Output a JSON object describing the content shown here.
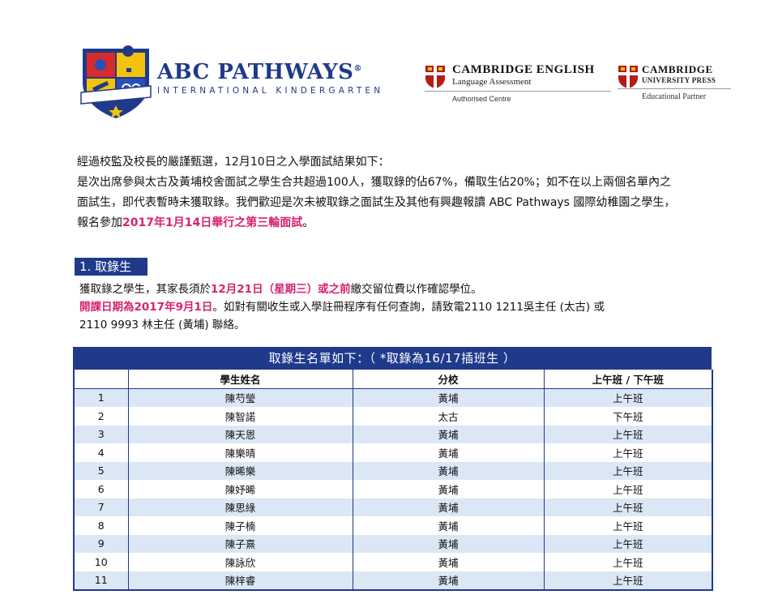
{
  "header": {
    "brand_name": "ABC PATHWAYS",
    "brand_mark": "®",
    "brand_sub": "INTERNATIONAL KINDERGARTEN",
    "crest_text": "ABC PATHWAYS",
    "cambridge_english": {
      "title": "CAMBRIDGE ENGLISH",
      "subtitle": "Language Assessment",
      "note": "Authorised Centre"
    },
    "cambridge_press": {
      "title": "CAMBRIDGE",
      "subtitle": "UNIVERSITY PRESS",
      "note": "Educational Partner"
    }
  },
  "intro": {
    "line1": "經過校監及校長的嚴謹甄選，12月10日之入學面試結果如下：",
    "line2": "是次出席參與太古及黃埔校舍面試之學生合共超過100人，獲取錄的佔67%，備取生佔20%；如不在以上兩個名單內之",
    "line3": "面試生，即代表暫時未獲取錄。我們歡迎是次未被取錄之面試生及其他有興趣報讀 ABC Pathways 國際幼稚園之學生，",
    "line4_a": "報名參加",
    "line4_b": "2017年1月14日舉行之第三輪面試",
    "line4_c": "。"
  },
  "section": {
    "heading": "1. 取錄生",
    "l1_a": "獲取錄之學生，其家長須於",
    "l1_b": "12月21日（星期三）或之前",
    "l1_c": "繳交留位費以作確認學位。",
    "l2_a": "開課日期為2017年9月1日",
    "l2_b": "。如對有關收生或入學註冊程序有任何查詢，請致電2110 1211吳主任 (太古) 或",
    "l3": "2110 9993 林主任 (黃埔) 聯絡。"
  },
  "table": {
    "title": "取錄生名單如下：（ *取錄為16/17插班生 ）",
    "headers": [
      "",
      "學生姓名",
      "分校",
      "上午班 / 下午班"
    ],
    "rows": [
      [
        "1",
        "陳芍瑩",
        "黃埔",
        "上午班"
      ],
      [
        "2",
        "陳智諾",
        "太古",
        "下午班"
      ],
      [
        "3",
        "陳天恩",
        "黃埔",
        "上午班"
      ],
      [
        "4",
        "陳樂晴",
        "黃埔",
        "上午班"
      ],
      [
        "5",
        "陳晞樂",
        "黃埔",
        "上午班"
      ],
      [
        "6",
        "陳妤晞",
        "黃埔",
        "上午班"
      ],
      [
        "7",
        "陳思綠",
        "黃埔",
        "上午班"
      ],
      [
        "8",
        "陳子楠",
        "黃埔",
        "上午班"
      ],
      [
        "9",
        "陳子熹",
        "黃埔",
        "上午班"
      ],
      [
        "10",
        "陳詠欣",
        "黃埔",
        "上午班"
      ],
      [
        "11",
        "陳梓睿",
        "黃埔",
        "上午班"
      ]
    ]
  },
  "colors": {
    "navy": "#1f3a8a",
    "highlight": "#d6246e",
    "stripe": "#dbe7f5"
  }
}
